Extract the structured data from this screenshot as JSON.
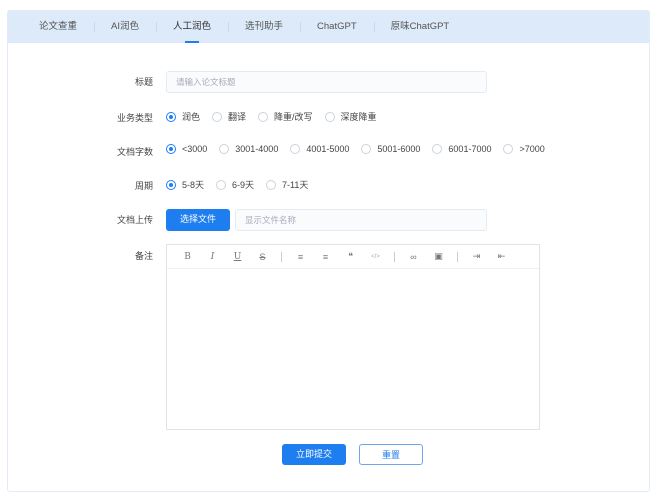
{
  "tabs": [
    "论文查重",
    "AI润色",
    "人工润色",
    "选刊助手",
    "ChatGPT",
    "原味ChatGPT"
  ],
  "form": {
    "title_label": "标题",
    "title_placeholder": "请输入论文标题",
    "type_label": "业务类型",
    "type_options": [
      "润色",
      "翻译",
      "降重/改写",
      "深度降重"
    ],
    "words_label": "文档字数",
    "words_options": [
      "<3000",
      "3001-4000",
      "4001-5000",
      "5001-6000",
      "6001-7000",
      ">7000"
    ],
    "period_label": "周期",
    "period_options": [
      "5-8天",
      "6-9天",
      "7-11天"
    ],
    "upload_label": "文档上传",
    "upload_button": "选择文件",
    "upload_placeholder": "显示文件名称",
    "notes_label": "备注",
    "toolbar": {
      "bold": "B",
      "italic": "I",
      "underline": "U",
      "strike": "S",
      "ordered": "≡",
      "bullet": "≡",
      "quote": "❝",
      "code": "</>",
      "link": "∞",
      "image": "▣",
      "indent": "⇥",
      "outdent": "⇤"
    },
    "submit": "立即提交",
    "reset": "重置"
  }
}
